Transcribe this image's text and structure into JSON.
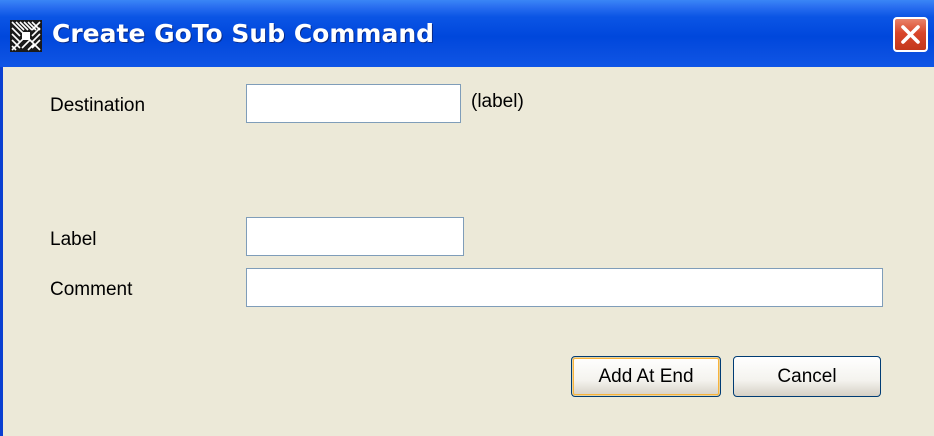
{
  "window": {
    "title": "Create GoTo Sub Command"
  },
  "icons": {
    "app": "checkered-app-icon",
    "close": "close-icon"
  },
  "colors": {
    "title_bar": "#0047dc",
    "dialog_bg": "#ece9d8",
    "close_button": "#d9462a"
  },
  "form": {
    "destination": {
      "label": "Destination",
      "value": "",
      "hint": "(label)"
    },
    "label": {
      "label": "Label",
      "value": ""
    },
    "comment": {
      "label": "Comment",
      "value": ""
    }
  },
  "buttons": {
    "add_at_end": "Add At End",
    "cancel": "Cancel"
  }
}
